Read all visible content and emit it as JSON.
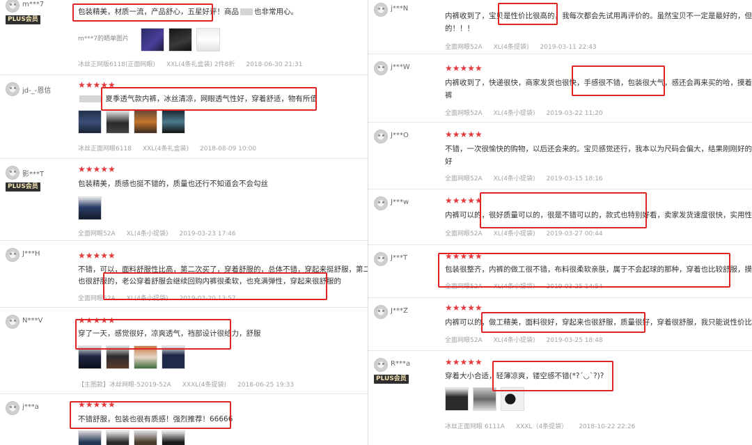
{
  "left_reviews": [
    {
      "user": "m***7",
      "plus": "PLUS会员",
      "text": "包装精美，材质一流，产品舒心，五星好评！商品",
      "text_tail": "也非常用心。",
      "broken_image_alt": "m***7的晒单图片",
      "meta": [
        "冰丝正网版6118(正面网眼)",
        "XXL(4条礼盒装) 2件8折",
        "2018-06-30 21:31"
      ]
    },
    {
      "user": "jd-_-恩信",
      "text": "夏季透气款内裤，冰丝清凉，网眼透气性好，穿着舒适，物有所值",
      "meta": [
        "冰丝正面网眼6118",
        "XXL(4条礼盒装)",
        "2018-08-09 10:00"
      ]
    },
    {
      "user": "影***T",
      "plus": "PLUS会员",
      "text": "包装精美，质感也挺不错的，质量也还行不知道会不会勾丝",
      "meta": [
        "全面网眼52A",
        "XL(4条小提袋)",
        "2019-03-23 17:46"
      ]
    },
    {
      "user": "J***H",
      "text": "不错，可以，面料舒服性比高，第二次买了，穿着舒服的，总体不错，穿起来挺舒服，第二次",
      "text2": "也很舒服的，老公穿着舒服会继续回购内裤很柔软，也充满弹性，穿起来很舒服的",
      "meta": [
        "全面网眼52A",
        "XL(4条小提袋)",
        "2019-03-20 13:57"
      ]
    },
    {
      "user": "N***V",
      "text": "穿了一天，感觉很好，凉爽透气，裆部设计很给力，舒服",
      "meta": [
        "【主图款】冰丝网眼-52019-52A",
        "XXXL(4条提袋)",
        "2018-06-25 19:33"
      ]
    },
    {
      "user": "j***a",
      "text": "不错舒服，包装也很有质感！强烈推荐！66666",
      "meta": []
    }
  ],
  "right_reviews": [
    {
      "user": "j***N",
      "text": "内裤收到了，宝贝是性价比很高的，我每次都会先试用再评价的。虽然宝贝不一定是最好的，但在同价",
      "text2": "的！！！",
      "meta": [
        "全面网眼52A",
        "XL(4条提袋)",
        "2019-03-11 22:43"
      ]
    },
    {
      "user": "j***W",
      "text": "内裤收到了，快递很快，商家发货也很快，手感很不错，包装很大气，感还会再来买的哈，摸着特别",
      "text2": "裤",
      "meta": [
        "全面网眼52A",
        "XL(4条小提袋)",
        "2019-03-22 11:20"
      ]
    },
    {
      "user": "J***O",
      "text": "不错，一次很愉快的购物，以后还会来的。宝贝感觉还行，我本以为尺码会偏大，结果刚刚好的，宝贝",
      "text2": "好",
      "meta": [
        "全面网眼52A",
        "XL(4条小提袋)",
        "2019-03-15 18:16"
      ]
    },
    {
      "user": "J***w",
      "text": "内裤可以的，很好质量可以的，很是不错可以的，款式也特别好看，卖家发货速度很快，实用性很强",
      "meta": [
        "全面网眼52A",
        "XL(4条小提袋)",
        "2019-03-27 00:44"
      ]
    },
    {
      "user": "J***T",
      "text": "包装很整齐，内裤的做工很不错，布料很柔软亲肤，属于不会起球的那种，穿着也比较舒服，摸着就",
      "meta": [
        "全面网眼52A",
        "XL(4条小提袋)",
        "2019-03-25 14:54"
      ]
    },
    {
      "user": "J***Z",
      "text": "内裤可以的，做工精美，面料很好，穿起来也很舒服，质量很好，穿着很舒服，我只能说性价比真的很",
      "meta": [
        "全面网眼52A",
        "XL(4条小提袋)",
        "2019-03-25 18:48"
      ]
    },
    {
      "user": "R***a",
      "plus": "PLUS会员",
      "text": "穿着大小合适，轻薄凉爽，镂空感不错(*?´◡`?)?",
      "meta": [
        "冰丝正面网眼 6111A",
        "XXXL（4条提袋）",
        "2018-10-22 22:26"
      ]
    }
  ],
  "stars": "★★★★★",
  "colors": {
    "star": "#e4393c",
    "highlight": "#e02424",
    "plus_bg": "#2f2f2f",
    "plus_fg": "#f2e3b3",
    "meta": "#a3a3a3"
  }
}
